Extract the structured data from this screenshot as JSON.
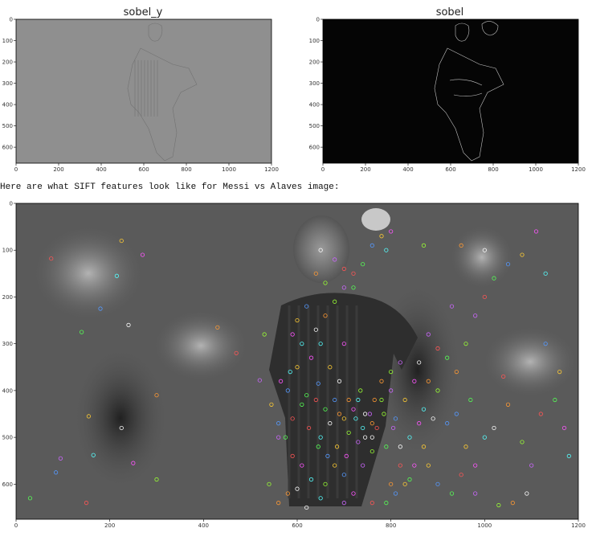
{
  "caption": "Here are what SIFT features look like for Messi vs Alaves image:",
  "chart_data": [
    {
      "type": "image",
      "title": "sobel_y",
      "xlim": [
        0,
        1200
      ],
      "ylim": [
        675,
        0
      ],
      "xticks": [
        0,
        200,
        400,
        600,
        800,
        1000,
        1200
      ],
      "yticks": [
        0,
        100,
        200,
        300,
        400,
        500,
        600
      ],
      "background": "#8f8f8f"
    },
    {
      "type": "image",
      "title": "sobel",
      "xlim": [
        0,
        1200
      ],
      "ylim": [
        675,
        0
      ],
      "xticks": [
        0,
        200,
        400,
        600,
        800,
        1000,
        1200
      ],
      "yticks": [
        0,
        100,
        200,
        300,
        400,
        500,
        600
      ],
      "background": "#050505"
    },
    {
      "type": "scatter",
      "title": "",
      "xlim": [
        0,
        1200
      ],
      "ylim": [
        675,
        0
      ],
      "xticks": [
        0,
        200,
        400,
        600,
        800,
        1000,
        1200
      ],
      "yticks": [
        0,
        100,
        200,
        300,
        400,
        500,
        600
      ],
      "background": "#5a5a5a",
      "series": [
        {
          "marker": "circle",
          "colors": [
            "#ff5555",
            "#55ff55",
            "#5599ff",
            "#ffcc33",
            "#ff55ff",
            "#55ffff",
            "#ffffff",
            "#ff9933",
            "#99ff33",
            "#cc66ff"
          ],
          "points": [
            [
              75,
              118
            ],
            [
              140,
              275
            ],
            [
              180,
              225
            ],
            [
              225,
              80
            ],
            [
              270,
              110
            ],
            [
              215,
              155
            ],
            [
              240,
              260
            ],
            [
              300,
              410
            ],
            [
              300,
              590
            ],
            [
              95,
              545
            ],
            [
              150,
              640
            ],
            [
              30,
              630
            ],
            [
              85,
              575
            ],
            [
              155,
              455
            ],
            [
              250,
              555
            ],
            [
              165,
              538
            ],
            [
              225,
              480
            ],
            [
              430,
              265
            ],
            [
              530,
              280
            ],
            [
              520,
              378
            ],
            [
              470,
              320
            ],
            [
              620,
              410
            ],
            [
              645,
              385
            ],
            [
              670,
              350
            ],
            [
              700,
              300
            ],
            [
              730,
              420
            ],
            [
              745,
              450
            ],
            [
              760,
              470
            ],
            [
              780,
              420
            ],
            [
              800,
              400
            ],
            [
              820,
              560
            ],
            [
              840,
              590
            ],
            [
              700,
              580
            ],
            [
              680,
              560
            ],
            [
              720,
              620
            ],
            [
              650,
              630
            ],
            [
              620,
              650
            ],
            [
              560,
              640
            ],
            [
              540,
              600
            ],
            [
              560,
              500
            ],
            [
              590,
              460
            ],
            [
              610,
              430
            ],
            [
              580,
              400
            ],
            [
              600,
              350
            ],
            [
              630,
              330
            ],
            [
              650,
              300
            ],
            [
              640,
              270
            ],
            [
              660,
              240
            ],
            [
              680,
              210
            ],
            [
              700,
              180
            ],
            [
              720,
              150
            ],
            [
              740,
              130
            ],
            [
              760,
              90
            ],
            [
              780,
              70
            ],
            [
              800,
              60
            ],
            [
              790,
              100
            ],
            [
              650,
              100
            ],
            [
              640,
              150
            ],
            [
              660,
              170
            ],
            [
              680,
              120
            ],
            [
              700,
              140
            ],
            [
              720,
              180
            ],
            [
              620,
              220
            ],
            [
              600,
              250
            ],
            [
              590,
              280
            ],
            [
              610,
              300
            ],
            [
              860,
              340
            ],
            [
              880,
              380
            ],
            [
              900,
              400
            ],
            [
              880,
              280
            ],
            [
              900,
              310
            ],
            [
              920,
              330
            ],
            [
              940,
              450
            ],
            [
              960,
              520
            ],
            [
              980,
              560
            ],
            [
              1000,
              500
            ],
            [
              1020,
              480
            ],
            [
              1050,
              430
            ],
            [
              1080,
              510
            ],
            [
              1100,
              560
            ],
            [
              1120,
              450
            ],
            [
              1150,
              420
            ],
            [
              1130,
              300
            ],
            [
              1160,
              360
            ],
            [
              1170,
              480
            ],
            [
              1180,
              540
            ],
            [
              1090,
              620
            ],
            [
              1060,
              640
            ],
            [
              1030,
              645
            ],
            [
              980,
              620
            ],
            [
              950,
              580
            ],
            [
              930,
              620
            ],
            [
              900,
              600
            ],
            [
              870,
              520
            ],
            [
              860,
              470
            ],
            [
              840,
              500
            ],
            [
              820,
              520
            ],
            [
              800,
              600
            ],
            [
              760,
              530
            ],
            [
              740,
              560
            ],
            [
              590,
              540
            ],
            [
              575,
              500
            ],
            [
              560,
              470
            ],
            [
              545,
              430
            ],
            [
              565,
              380
            ],
            [
              585,
              360
            ],
            [
              690,
              380
            ],
            [
              710,
              420
            ],
            [
              735,
              400
            ],
            [
              755,
              450
            ],
            [
              770,
              480
            ],
            [
              790,
              520
            ],
            [
              810,
              460
            ],
            [
              830,
              420
            ],
            [
              850,
              380
            ],
            [
              870,
              440
            ],
            [
              890,
              460
            ],
            [
              940,
              360
            ],
            [
              960,
              300
            ],
            [
              980,
              240
            ],
            [
              1000,
              200
            ],
            [
              1020,
              160
            ],
            [
              1050,
              130
            ],
            [
              1080,
              110
            ],
            [
              1110,
              60
            ],
            [
              1130,
              150
            ],
            [
              1000,
              100
            ],
            [
              950,
              90
            ],
            [
              870,
              90
            ],
            [
              930,
              220
            ],
            [
              1040,
              370
            ],
            [
              970,
              420
            ],
            [
              920,
              470
            ],
            [
              880,
              560
            ],
            [
              610,
              560
            ],
            [
              630,
              590
            ],
            [
              600,
              610
            ],
            [
              580,
              620
            ],
            [
              660,
              600
            ],
            [
              700,
              640
            ],
            [
              760,
              640
            ],
            [
              790,
              640
            ],
            [
              810,
              620
            ],
            [
              830,
              600
            ],
            [
              850,
              560
            ],
            [
              650,
              500
            ],
            [
              670,
              470
            ],
            [
              690,
              450
            ],
            [
              710,
              490
            ],
            [
              730,
              510
            ],
            [
              625,
              480
            ],
            [
              645,
              520
            ],
            [
              665,
              540
            ],
            [
              685,
              520
            ],
            [
              705,
              540
            ],
            [
              725,
              460
            ],
            [
              745,
              500
            ],
            [
              765,
              420
            ],
            [
              785,
              450
            ],
            [
              805,
              480
            ],
            [
              640,
              420
            ],
            [
              660,
              440
            ],
            [
              680,
              420
            ],
            [
              700,
              460
            ],
            [
              720,
              440
            ],
            [
              740,
              480
            ],
            [
              760,
              500
            ],
            [
              780,
              380
            ],
            [
              800,
              360
            ],
            [
              820,
              340
            ]
          ]
        }
      ]
    }
  ]
}
